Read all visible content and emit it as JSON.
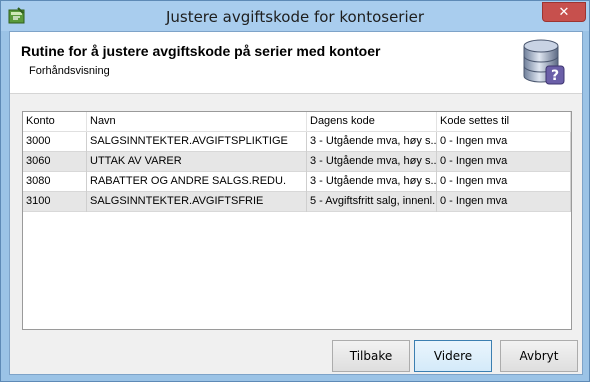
{
  "window": {
    "title": "Justere avgiftskode for kontoserier",
    "close_glyph": "✕"
  },
  "header": {
    "title": "Rutine for å justere avgiftskode på serier med kontoer",
    "subtitle": "Forhåndsvisning",
    "icon": "database-help-icon"
  },
  "grid": {
    "columns": [
      "Konto",
      "Navn",
      "Dagens kode",
      "Kode settes til"
    ],
    "rows": [
      {
        "konto": "3000",
        "navn": "SALGSINNTEKTER.AVGIFTSPLIKTIGE",
        "dagens_kode": "3 - Utgående mva, høy s...",
        "ny_kode": "0 - Ingen mva"
      },
      {
        "konto": "3060",
        "navn": "UTTAK AV VARER",
        "dagens_kode": "3 - Utgående mva, høy s...",
        "ny_kode": "0 - Ingen mva"
      },
      {
        "konto": "3080",
        "navn": "RABATTER OG ANDRE SALGS.REDU.",
        "dagens_kode": "3 - Utgående mva, høy s...",
        "ny_kode": "0 - Ingen mva"
      },
      {
        "konto": "3100",
        "navn": "SALGSINNTEKTER.AVGIFTSFRIE",
        "dagens_kode": "5 - Avgiftsfritt salg, innenl...",
        "ny_kode": "0 - Ingen mva"
      }
    ]
  },
  "buttons": {
    "back": "Tilbake",
    "next": "Videre",
    "cancel": "Avbryt"
  },
  "colors": {
    "titlebar": "#a9cdee",
    "close": "#c7504d",
    "row_alt": "#e6e6e6"
  }
}
